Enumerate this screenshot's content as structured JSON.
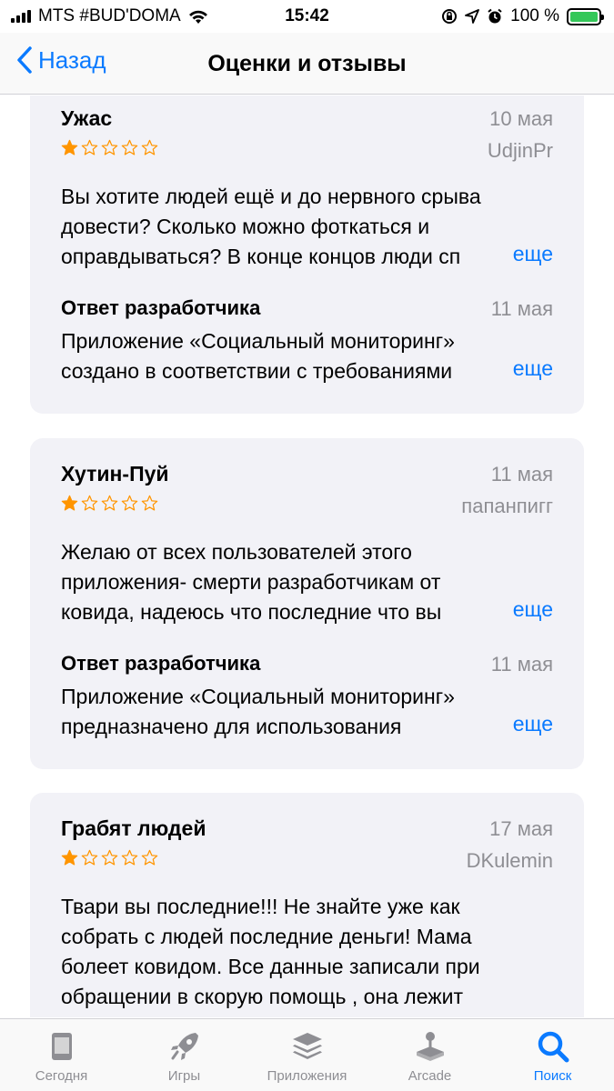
{
  "status_bar": {
    "carrier": "MTS #BUD'DOMA",
    "time": "15:42",
    "battery_percent": "100 %"
  },
  "nav": {
    "back_label": "Назад",
    "title": "Оценки и отзывы"
  },
  "reviews": [
    {
      "title": "Ужас",
      "date": "10 мая",
      "author": "UdjinPr",
      "rating": 1,
      "body": [
        "Вы хотите людей ещё и до нервного срыва",
        "довести? Сколько можно фоткаться и",
        "оправдываться? В конце концов люди сп"
      ],
      "more": "еще",
      "dev_title": "Ответ разработчика",
      "dev_date": "11 мая",
      "dev_body": [
        "Приложение «Социальный мониторинг»",
        "создано в соответствии с требованиями"
      ],
      "dev_more": "еще"
    },
    {
      "title": "Хутин-Пуй",
      "date": "11 мая",
      "author": "папанпигг",
      "rating": 1,
      "body": [
        "Желаю от всех пользователей этого",
        "приложения- смерти разработчикам от",
        "ковида, надеюсь что последние что вы"
      ],
      "more": "еще",
      "dev_title": "Ответ разработчика",
      "dev_date": "11 мая",
      "dev_body": [
        "Приложение «Социальный мониторинг»",
        "предназначено для использования"
      ],
      "dev_more": "еще"
    },
    {
      "title": "Грабят людей",
      "date": "17 мая",
      "author": "DKulemin",
      "rating": 1,
      "body": [
        "Твари вы последние!!! Не знайте уже как",
        "собрать с людей последние деньги! Мама",
        "болеет ковидом. Все данные записали при",
        "обращении в скорую помощь , она лежит"
      ]
    }
  ],
  "tab_bar": {
    "items": [
      {
        "label": "Сегодня",
        "icon": "today-icon"
      },
      {
        "label": "Игры",
        "icon": "rocket-icon"
      },
      {
        "label": "Приложения",
        "icon": "apps-stack-icon"
      },
      {
        "label": "Arcade",
        "icon": "joystick-icon"
      },
      {
        "label": "Поиск",
        "icon": "search-icon"
      }
    ],
    "active_index": 4
  },
  "colors": {
    "accent": "#0a7aff",
    "star": "#ff9500",
    "card_bg": "#f2f2f7",
    "secondary_text": "#8e8e93"
  }
}
